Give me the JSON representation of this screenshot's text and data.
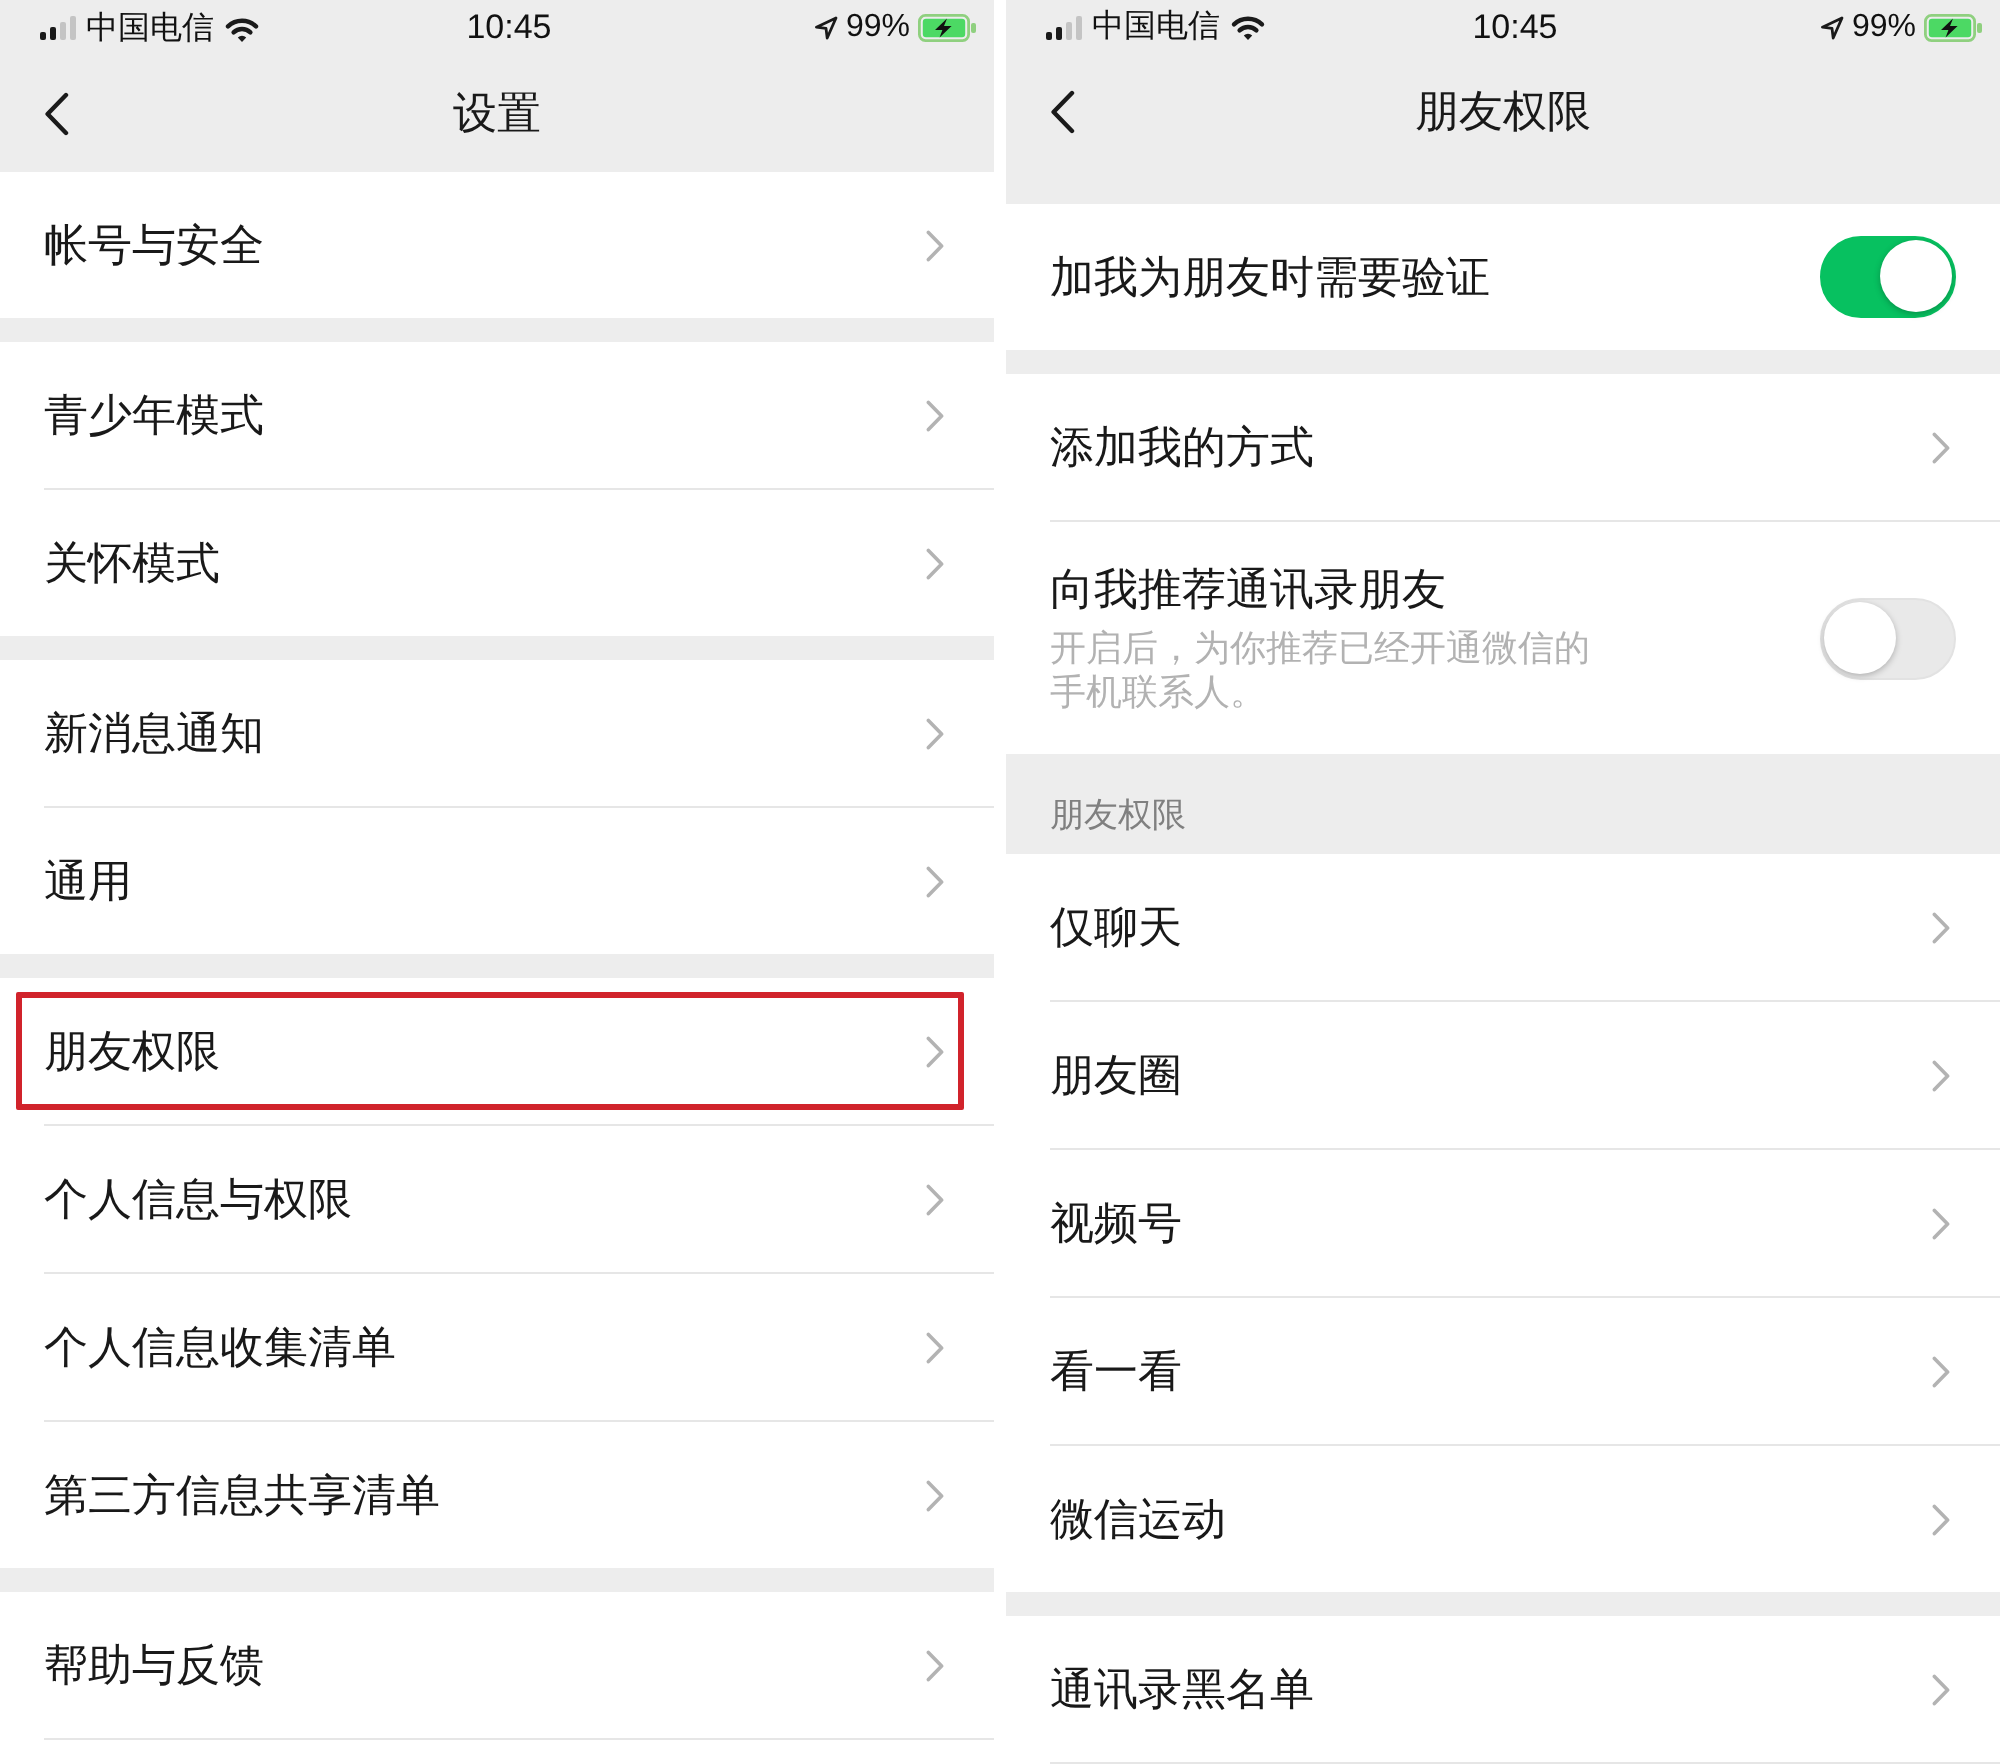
{
  "screens": [
    {
      "status_bar": {
        "carrier": "中国电信",
        "time": "10:45",
        "battery": "99%"
      },
      "nav_bar": {
        "title": "设置"
      },
      "groups": [
        {
          "items": [
            {
              "kind": "link",
              "label": "帐号与安全",
              "highlighted": false
            }
          ]
        },
        {
          "items": [
            {
              "kind": "link",
              "label": "青少年模式",
              "highlighted": false
            },
            {
              "kind": "link",
              "label": "关怀模式",
              "highlighted": false
            }
          ]
        },
        {
          "items": [
            {
              "kind": "link",
              "label": "新消息通知",
              "highlighted": false
            },
            {
              "kind": "link",
              "label": "通用",
              "highlighted": false
            }
          ]
        },
        {
          "items": [
            {
              "kind": "link",
              "label": "朋友权限",
              "highlighted": true
            },
            {
              "kind": "link",
              "label": "个人信息与权限",
              "highlighted": false
            },
            {
              "kind": "link",
              "label": "个人信息收集清单",
              "highlighted": false
            },
            {
              "kind": "link",
              "label": "第三方信息共享清单",
              "highlighted": false
            }
          ]
        },
        {
          "items": [
            {
              "kind": "link",
              "label": "帮助与反馈",
              "highlighted": false
            }
          ]
        }
      ]
    },
    {
      "status_bar": {
        "carrier": "中国电信",
        "time": "10:45",
        "battery": "99%"
      },
      "nav_bar": {
        "title": "朋友权限"
      },
      "groups": [
        {
          "items": [
            {
              "kind": "toggle",
              "label": "加我为朋友时需要验证",
              "on": true
            }
          ]
        },
        {
          "items": [
            {
              "kind": "link",
              "label": "添加我的方式"
            },
            {
              "kind": "toggle",
              "label": "向我推荐通讯录朋友",
              "description": "开启后，为你推荐已经开通微信的手机联系人。",
              "on": false
            }
          ]
        },
        {
          "header": "朋友权限",
          "items": [
            {
              "kind": "link",
              "label": "仅聊天"
            },
            {
              "kind": "link",
              "label": "朋友圈"
            },
            {
              "kind": "link",
              "label": "视频号"
            },
            {
              "kind": "link",
              "label": "看一看"
            },
            {
              "kind": "link",
              "label": "微信运动"
            }
          ]
        },
        {
          "items": [
            {
              "kind": "link",
              "label": "通讯录黑名单"
            }
          ]
        }
      ]
    }
  ]
}
